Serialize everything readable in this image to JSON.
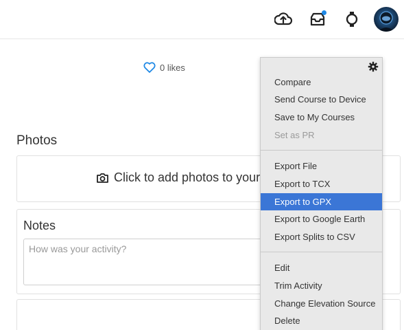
{
  "header": {
    "upload_icon": "cloud-upload-icon",
    "inbox_icon": "inbox-tray-icon",
    "watch_icon": "watch-icon",
    "notification_color": "#1e88e5"
  },
  "activity": {
    "likes_label": "0 likes",
    "heart_color": "#1e88e5"
  },
  "photos": {
    "title": "Photos",
    "prompt": "Click to add photos to your"
  },
  "notes": {
    "title": "Notes",
    "placeholder": "How was your activity?"
  },
  "menu": {
    "gear_icon": "gear-icon",
    "groups": [
      [
        {
          "label": "Compare",
          "disabled": false,
          "active": false
        },
        {
          "label": "Send Course to Device",
          "disabled": false,
          "active": false
        },
        {
          "label": "Save to My Courses",
          "disabled": false,
          "active": false
        },
        {
          "label": "Set as PR",
          "disabled": true,
          "active": false
        }
      ],
      [
        {
          "label": "Export File",
          "disabled": false,
          "active": false
        },
        {
          "label": "Export to TCX",
          "disabled": false,
          "active": false
        },
        {
          "label": "Export to GPX",
          "disabled": false,
          "active": true
        },
        {
          "label": "Export to Google Earth",
          "disabled": false,
          "active": false
        },
        {
          "label": "Export Splits to CSV",
          "disabled": false,
          "active": false
        }
      ],
      [
        {
          "label": "Edit",
          "disabled": false,
          "active": false
        },
        {
          "label": "Trim Activity",
          "disabled": false,
          "active": false
        },
        {
          "label": "Change Elevation Source",
          "disabled": false,
          "active": false
        },
        {
          "label": "Delete",
          "disabled": false,
          "active": false
        }
      ]
    ],
    "highlight_color": "#3b76d6"
  }
}
